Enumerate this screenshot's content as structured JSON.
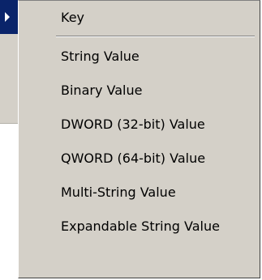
{
  "new_submenu": {
    "key_label": "Key",
    "items": [
      {
        "label": "String Value"
      },
      {
        "label": "Binary Value"
      },
      {
        "label": "DWORD (32-bit) Value"
      },
      {
        "label": "QWORD (64-bit) Value"
      },
      {
        "label": "Multi-String Value"
      },
      {
        "label": "Expandable String Value"
      }
    ]
  },
  "colors": {
    "menu_background": "#d4d0c8",
    "highlight": "#0a246a",
    "text": "#000000"
  },
  "icons": {
    "parent_arrow": "submenu-arrow-icon"
  }
}
